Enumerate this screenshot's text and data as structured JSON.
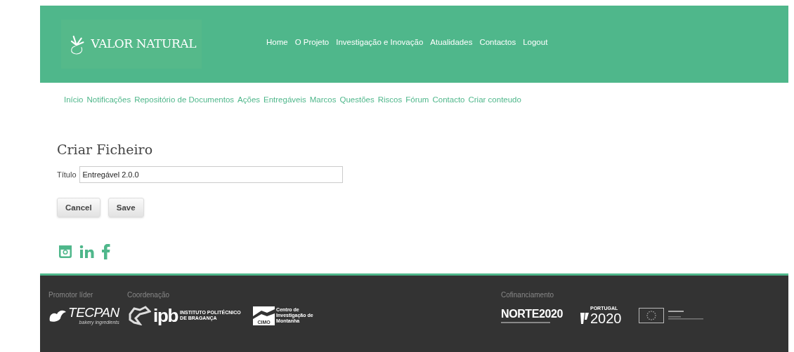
{
  "header": {
    "logo": "VALOR NATURAL",
    "nav": [
      {
        "label": "Home"
      },
      {
        "label": "O Projeto"
      },
      {
        "label": "Investigação e Inovação"
      },
      {
        "label": "Atualidades"
      },
      {
        "label": "Contactos"
      },
      {
        "label": "Logout"
      }
    ]
  },
  "subnav": [
    {
      "label": "Início"
    },
    {
      "label": "Notificações"
    },
    {
      "label": "Repositório de Documentos"
    },
    {
      "label": "Ações"
    },
    {
      "label": "Entregáveis"
    },
    {
      "label": "Marcos"
    },
    {
      "label": "Questões"
    },
    {
      "label": "Riscos"
    },
    {
      "label": "Fórum"
    },
    {
      "label": "Contacto"
    },
    {
      "label": "Criar conteudo"
    }
  ],
  "form": {
    "title": "Criar Ficheiro",
    "field": {
      "label": "Título",
      "value": "Entregável 2.0.0"
    },
    "buttons": [
      "Cancel",
      "Save"
    ]
  },
  "social": [
    {
      "kind": "instagram"
    },
    {
      "kind": "linkedin"
    },
    {
      "kind": "facebook"
    }
  ],
  "footer": {
    "groups": [
      {
        "label": "Promotor líder",
        "logos": [
          {
            "kind": "tecpan",
            "name": "TECPAN",
            "sub": "bakery ingredients"
          }
        ]
      },
      {
        "label": "Coordenação",
        "logos": [
          {
            "kind": "ipb",
            "name": "ipb",
            "sub": "INSTITUTO POLITÉCNICO DE BRAGANÇA"
          },
          {
            "kind": "cimo",
            "name": "CIMO",
            "sub": "Centro de Investigação de Montanha"
          }
        ]
      },
      {
        "label": "Cofinanciamento",
        "logos": [
          {
            "kind": "norte",
            "name": "NORTE2020"
          },
          {
            "kind": "pt2020",
            "name": "2020",
            "sub": "PORTUGAL"
          },
          {
            "kind": "eu"
          }
        ]
      }
    ]
  }
}
